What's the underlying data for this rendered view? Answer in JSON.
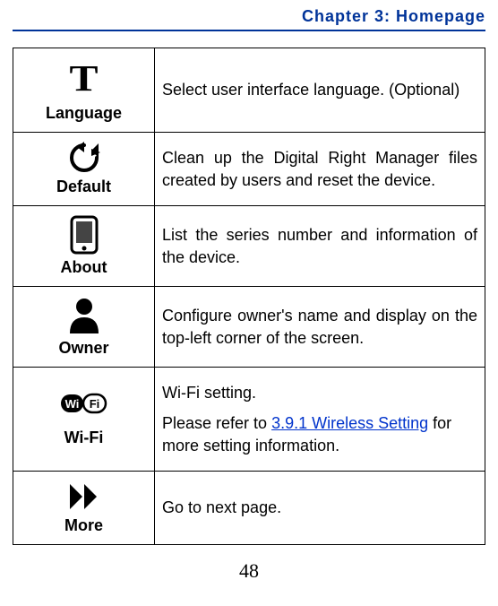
{
  "header": {
    "chapter": "Chapter 3: Homepage"
  },
  "rows": {
    "language": {
      "label": "Language",
      "desc": "Select user interface language. (Optional)"
    },
    "default": {
      "label": "Default",
      "desc": "Clean up the Digital Right Manager files created by users and reset the device."
    },
    "about": {
      "label": "About",
      "desc": "List the series number and information of the device."
    },
    "owner": {
      "label": "Owner",
      "desc": "Configure owner's name and display on the top-left corner of the screen."
    },
    "wifi": {
      "label": "Wi-Fi",
      "desc1": "Wi-Fi setting.",
      "desc2a": "Please refer to ",
      "link": "3.9.1 Wireless Setting",
      "desc2b": " for more setting information."
    },
    "more": {
      "label": "More",
      "desc": "Go to next page."
    }
  },
  "pageNumber": "48"
}
